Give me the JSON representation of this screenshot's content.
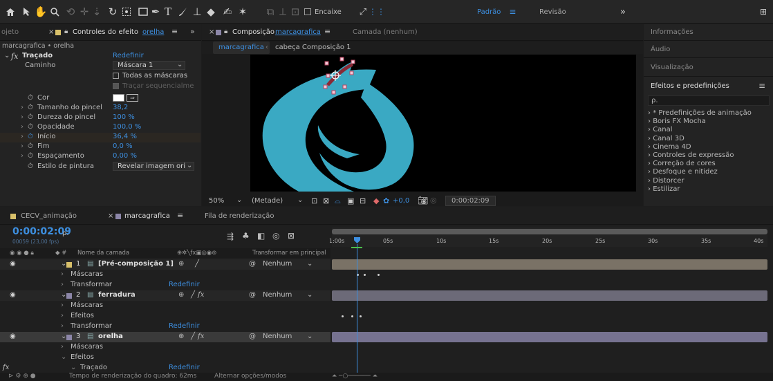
{
  "toolbar": {
    "home_icon": "home-icon",
    "encaixe_label": "Encaixe",
    "workspace_default": "Padrão",
    "workspace_review": "Revisão",
    "more_label": "»"
  },
  "effects_panel": {
    "left_tab_fragment": "ojeto",
    "tab_title": "Controles do efeito",
    "tab_target": "orelha",
    "breadcrumb": "marcagrafica • orelha",
    "effect_name": "Traçado",
    "reset": "Redefinir",
    "rows": {
      "path_label": "Caminho",
      "path_value": "Máscara 1",
      "all_masks": "Todas as máscaras",
      "sequential": "Traçar sequencialme",
      "color": "Cor",
      "brush_size": "Tamanho do pincel",
      "brush_size_value": "38,2",
      "brush_hardness": "Dureza do pincel",
      "brush_hardness_value": "100 %",
      "opacity": "Opacidade",
      "opacity_value": "100,0 %",
      "start": "Início",
      "start_value": "36,4 %",
      "end": "Fim",
      "end_value": "0,0 %",
      "spacing": "Espaçamento",
      "spacing_value": "0,00 %",
      "paint_style": "Estilo de pintura",
      "paint_style_value": "Revelar imagem ori"
    }
  },
  "comp_panel": {
    "tab_title": "Composição",
    "tab_target": "marcagrafica",
    "layer_tab": "Camada (nenhum)",
    "crumb_active": "marcagrafica",
    "crumb_next": "cabeça Composição 1",
    "zoom": "50%",
    "resolution": "(Metade)",
    "exposure": "+0,0",
    "timecode": "0:00:02:09"
  },
  "right_panel": {
    "info": "Informações",
    "audio": "Áudio",
    "preview": "Visualização",
    "effects_title": "Efeitos e predefinições",
    "search_placeholder": "ρ.",
    "items": [
      "* Predefinições de animação",
      "Boris FX Mocha",
      "Canal",
      "Canal 3D",
      "Cinema 4D",
      "Controles de expressão",
      "Correção de cores",
      "Desfoque e nitidez",
      "Distorcer",
      "Estilizar"
    ]
  },
  "timeline": {
    "tab1": "CECV_animação",
    "tab2": "marcagrafica",
    "tab3": "Fila de renderização",
    "current_time": "0:00:02:09",
    "frame_info": "00059 (23,00 fps)",
    "header_layer_name": "Nome da camada",
    "header_switches": "Transformar em principal",
    "ruler": [
      "1:00s",
      "05s",
      "10s",
      "15s",
      "20s",
      "25s",
      "30s",
      "35s",
      "40s"
    ],
    "layers": [
      {
        "num": "1",
        "name": "[Pré-composição 1]",
        "parent": "Nenhum"
      },
      {
        "num": "2",
        "name": "ferradura",
        "parent": "Nenhum"
      },
      {
        "num": "3",
        "name": "orelha",
        "parent": "Nenhum"
      }
    ],
    "sub": {
      "masks": "Máscaras",
      "transform": "Transformar",
      "effects": "Efeitos",
      "stroke": "Traçado",
      "reset": "Redefinir"
    },
    "status_render": "Tempo de renderização do quadro: 62ms",
    "status_toggle": "Alternar opções/modos"
  },
  "colors": {
    "accent": "#3d8fe0",
    "logo_teal": "#3aa9c3",
    "label_yellow": "#d8c06a",
    "label_purple": "#8c86a8"
  }
}
